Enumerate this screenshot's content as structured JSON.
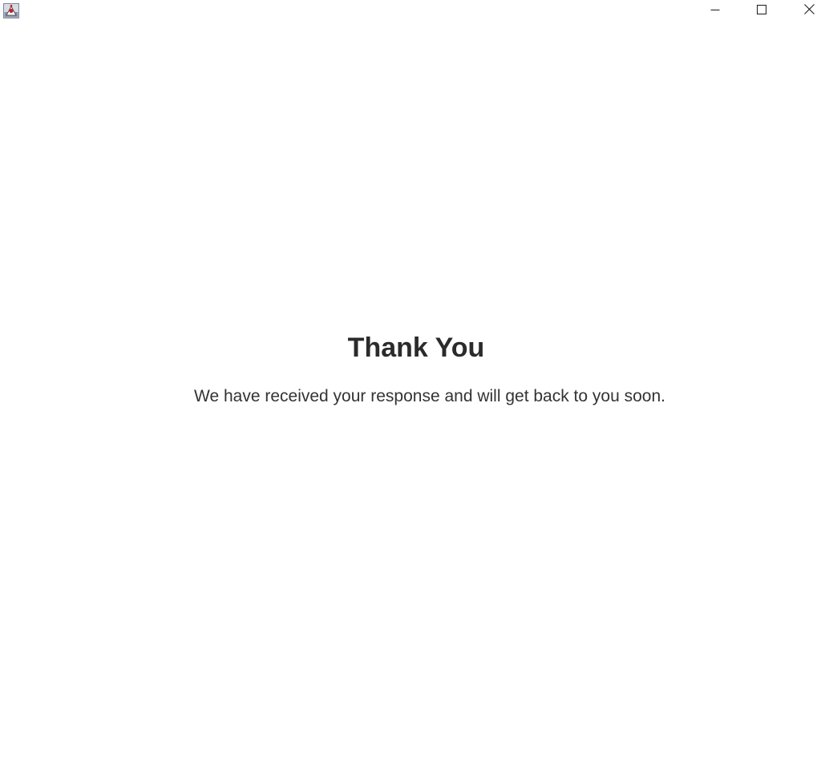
{
  "window": {
    "controls": {
      "minimize_icon": "minimize-icon",
      "maximize_icon": "maximize-icon",
      "close_icon": "close-icon"
    }
  },
  "page": {
    "heading": "Thank You",
    "message": "We have received your response and will get back to you soon."
  },
  "colors": {
    "background": "#ffffff",
    "heading_text": "#2b2b2b",
    "body_text": "#333333"
  }
}
